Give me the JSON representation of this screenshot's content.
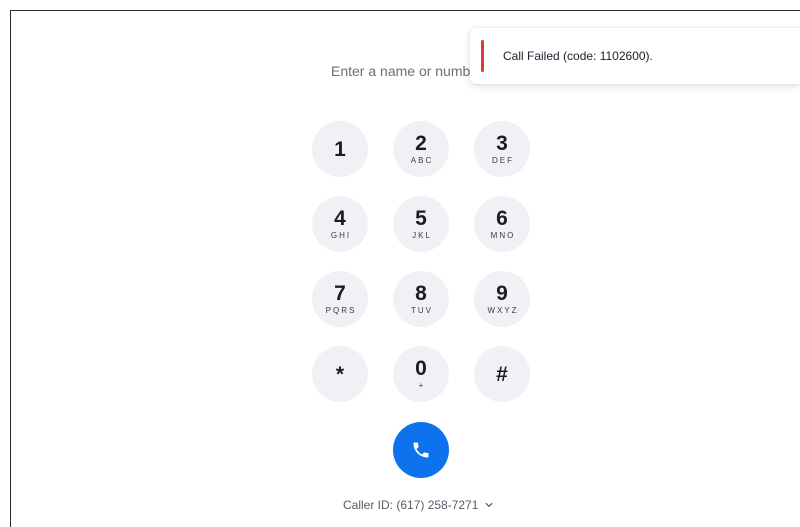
{
  "dialer": {
    "input_placeholder": "Enter a name or number",
    "input_value": ""
  },
  "keypad": [
    {
      "digit": "1",
      "letters": ""
    },
    {
      "digit": "2",
      "letters": "ABC"
    },
    {
      "digit": "3",
      "letters": "DEF"
    },
    {
      "digit": "4",
      "letters": "GHI"
    },
    {
      "digit": "5",
      "letters": "JKL"
    },
    {
      "digit": "6",
      "letters": "MNO"
    },
    {
      "digit": "7",
      "letters": "PQRS"
    },
    {
      "digit": "8",
      "letters": "TUV"
    },
    {
      "digit": "9",
      "letters": "WXYZ"
    },
    {
      "digit": "*",
      "letters": ""
    },
    {
      "digit": "0",
      "letters": "+"
    },
    {
      "digit": "#",
      "letters": ""
    }
  ],
  "call": {
    "icon": "phone-icon",
    "color": "#0e72ed"
  },
  "caller_id": {
    "label": "Caller ID: (617) 258-7271",
    "icon": "chevron-down-icon"
  },
  "toast": {
    "message": "Call Failed (code: 1102600).",
    "accent_color": "#e8343c"
  }
}
